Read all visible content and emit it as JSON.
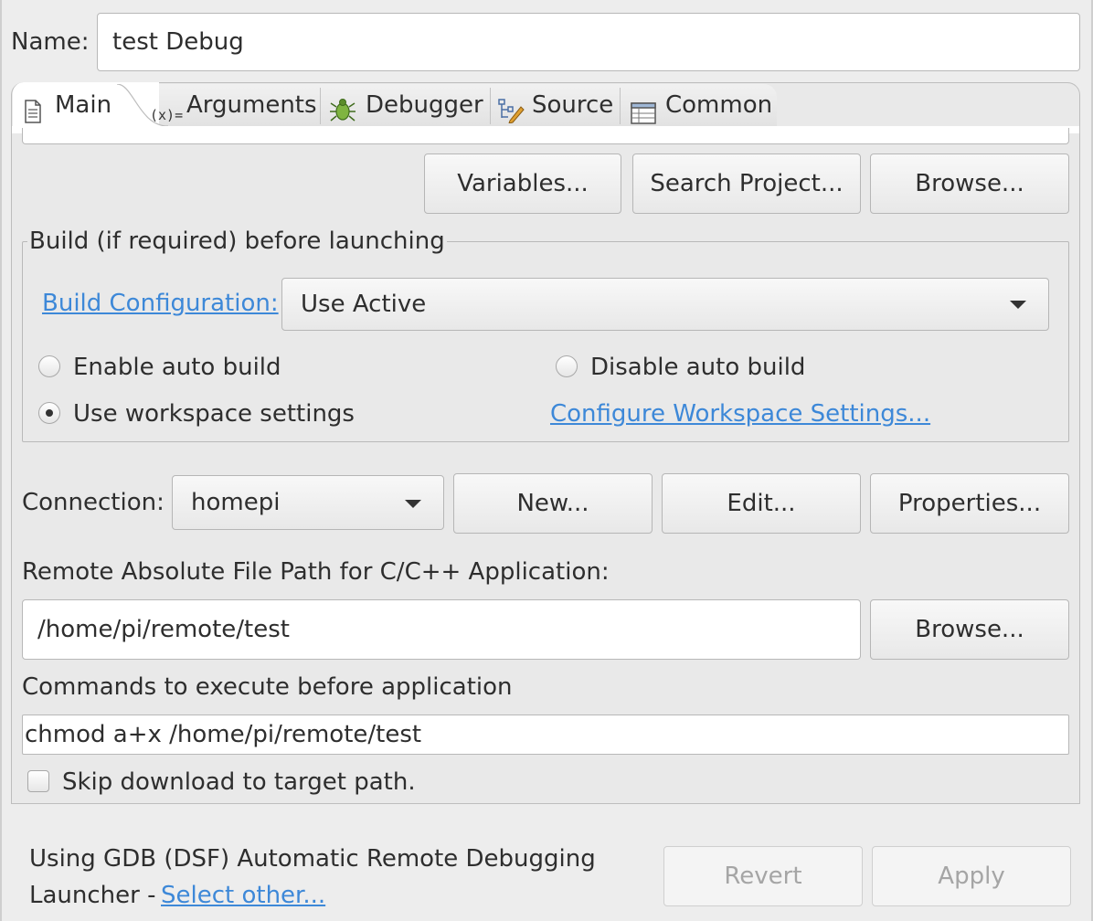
{
  "name": {
    "label": "Name:",
    "value": "test Debug"
  },
  "tabs": [
    {
      "label": "Main",
      "icon": "document-icon",
      "active": true
    },
    {
      "label": "Arguments",
      "icon": "variable-x-icon"
    },
    {
      "label": "Debugger",
      "icon": "bug-icon"
    },
    {
      "label": "Source",
      "icon": "source-tree-icon"
    },
    {
      "label": "Common",
      "icon": "table-icon"
    }
  ],
  "project_buttons": {
    "variables": "Variables...",
    "search_project": "Search Project...",
    "browse": "Browse..."
  },
  "build": {
    "group_title": "Build (if required) before launching",
    "config_link": "Build Configuration:",
    "config_value": "Use Active",
    "options": {
      "enable": "Enable auto build",
      "disable": "Disable auto build",
      "workspace": "Use workspace settings",
      "selected": "workspace"
    },
    "configure_link": "Configure Workspace Settings..."
  },
  "connection": {
    "label": "Connection:",
    "value": "homepi",
    "new_btn": "New...",
    "edit_btn": "Edit...",
    "properties_btn": "Properties..."
  },
  "remote_path": {
    "label": "Remote Absolute File Path for C/C++ Application:",
    "value": "/home/pi/remote/test",
    "browse_btn": "Browse..."
  },
  "commands": {
    "label": "Commands to execute before application",
    "value": "chmod a+x /home/pi/remote/test"
  },
  "skip_download": {
    "label": "Skip download to target path.",
    "checked": false
  },
  "footer": {
    "launcher_line1": "Using GDB (DSF) Automatic Remote Debugging",
    "launcher_line2": "Launcher -",
    "select_other": "Select other...",
    "revert_btn": "Revert",
    "apply_btn": "Apply"
  },
  "colors": {
    "link": "#3d88d8",
    "background": "#ededed",
    "disabled_text": "#a5a5a5"
  }
}
